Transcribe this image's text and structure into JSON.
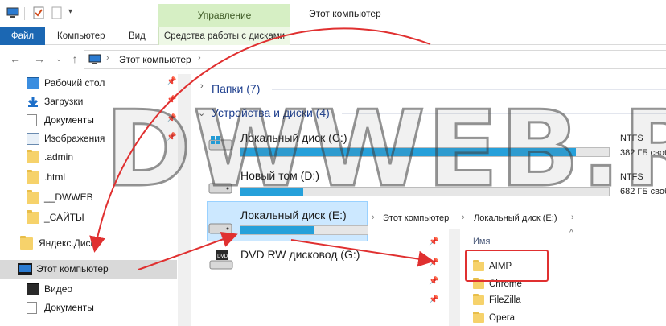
{
  "title_bar": {
    "manage_tab": "Управление",
    "window_title": "Этот компьютер"
  },
  "ribbon": {
    "tabs": [
      "Файл",
      "Компьютер",
      "Вид",
      "Средства работы с дисками"
    ]
  },
  "address_bar": {
    "path": "Этот компьютер"
  },
  "nav_pane": {
    "items": [
      {
        "label": "Рабочий стол",
        "icon": "desktop-icon",
        "pinned": true
      },
      {
        "label": "Загрузки",
        "icon": "download-icon",
        "pinned": true
      },
      {
        "label": "Документы",
        "icon": "documents-icon",
        "pinned": true
      },
      {
        "label": "Изображения",
        "icon": "pictures-icon",
        "pinned": true
      },
      {
        "label": ".admin",
        "icon": "folder-icon",
        "pinned": false
      },
      {
        "label": ".html",
        "icon": "folder-icon",
        "pinned": false
      },
      {
        "label": "__DWWEB",
        "icon": "folder-icon",
        "pinned": false
      },
      {
        "label": "_САЙТЫ",
        "icon": "folder-icon",
        "pinned": false
      },
      {
        "label": "Яндекс.Диск",
        "icon": "yandex-disk-icon",
        "pinned": false
      },
      {
        "label": "Этот компьютер",
        "icon": "computer-icon",
        "pinned": false,
        "selected": true
      },
      {
        "label": "Видео",
        "icon": "video-icon",
        "pinned": false
      },
      {
        "label": "Документы",
        "icon": "documents-icon",
        "pinned": false
      }
    ]
  },
  "content": {
    "groups": {
      "folders": "Папки (7)",
      "devices": "Устройства и диски (4)"
    },
    "drives": [
      {
        "name": "Локальный диск (C:)",
        "fs": "NTFS",
        "free": "382 ГБ своб",
        "usage": 0.91,
        "icon": "windows-drive-icon"
      },
      {
        "name": "Новый том (D:)",
        "fs": "NTFS",
        "free": "682 ГБ своб",
        "usage": 0.17,
        "icon": "hard-drive-icon"
      },
      {
        "name": "Локальный диск (E:)",
        "fs": "",
        "free": "",
        "usage": 0.2,
        "icon": "hard-drive-icon"
      },
      {
        "name": "DVD RW дисковод (G:)",
        "fs": "",
        "free": "",
        "usage": null,
        "icon": "dvd-drive-icon"
      }
    ]
  },
  "popup": {
    "breadcrumb": [
      "Этот компьютер",
      "Локальный диск (E:)"
    ],
    "column_header": "Имя",
    "items": [
      "AIMP",
      "Chrome",
      "FileZilla",
      "Opera"
    ]
  },
  "watermark": "DWWEB.RU",
  "colors": {
    "accent_blue": "#1b67b3",
    "manage_green": "#d6efc4",
    "drive_bar": "#26a0da",
    "annotation_red": "#e03030"
  }
}
